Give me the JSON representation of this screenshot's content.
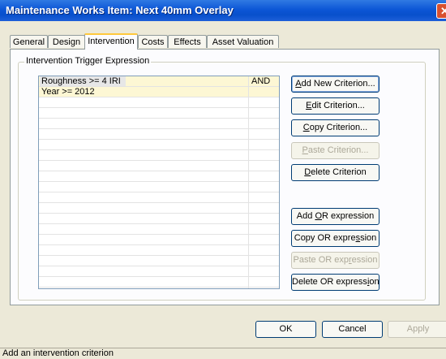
{
  "window": {
    "title": "Maintenance Works Item: Next 40mm Overlay",
    "close_glyph": "✕"
  },
  "tabs": [
    {
      "label": "General"
    },
    {
      "label": "Design"
    },
    {
      "label": "Intervention"
    },
    {
      "label": "Costs"
    },
    {
      "label": "Effects"
    },
    {
      "label": "Asset Valuation"
    }
  ],
  "active_tab": "Intervention",
  "group": {
    "label": "Intervention Trigger Expression"
  },
  "criteria": [
    {
      "expression": "Roughness >= 4 IRI",
      "operator": "AND"
    },
    {
      "expression": "Year >= 2012",
      "operator": ""
    }
  ],
  "buttons": {
    "add_new": {
      "pre": "",
      "key": "A",
      "post": "dd New Criterion..."
    },
    "edit": {
      "pre": "",
      "key": "E",
      "post": "dit Criterion..."
    },
    "copy": {
      "pre": "",
      "key": "C",
      "post": "opy Criterion..."
    },
    "paste": {
      "pre": "",
      "key": "P",
      "post": "aste Criterion..."
    },
    "delete": {
      "pre": "",
      "key": "D",
      "post": "elete Criterion"
    },
    "add_or": {
      "pre": "Add ",
      "key": "O",
      "post": "R expression"
    },
    "copy_or": {
      "pre": "Copy OR expre",
      "key": "s",
      "post": "sion"
    },
    "paste_or": {
      "pre": "Paste OR exp",
      "key": "r",
      "post": "ession"
    },
    "delete_or": {
      "pre": "Delete OR express",
      "key": "i",
      "post": "on"
    }
  },
  "dialog_buttons": {
    "ok": "OK",
    "cancel": "Cancel",
    "apply": "Apply"
  },
  "status": {
    "text": "Add an intervention criterion"
  },
  "colors": {
    "title_bar": "#0c56d6",
    "tab_highlight": "#ffc83c",
    "row_fill": "#fdf7d4",
    "close_button": "#d8502f"
  }
}
